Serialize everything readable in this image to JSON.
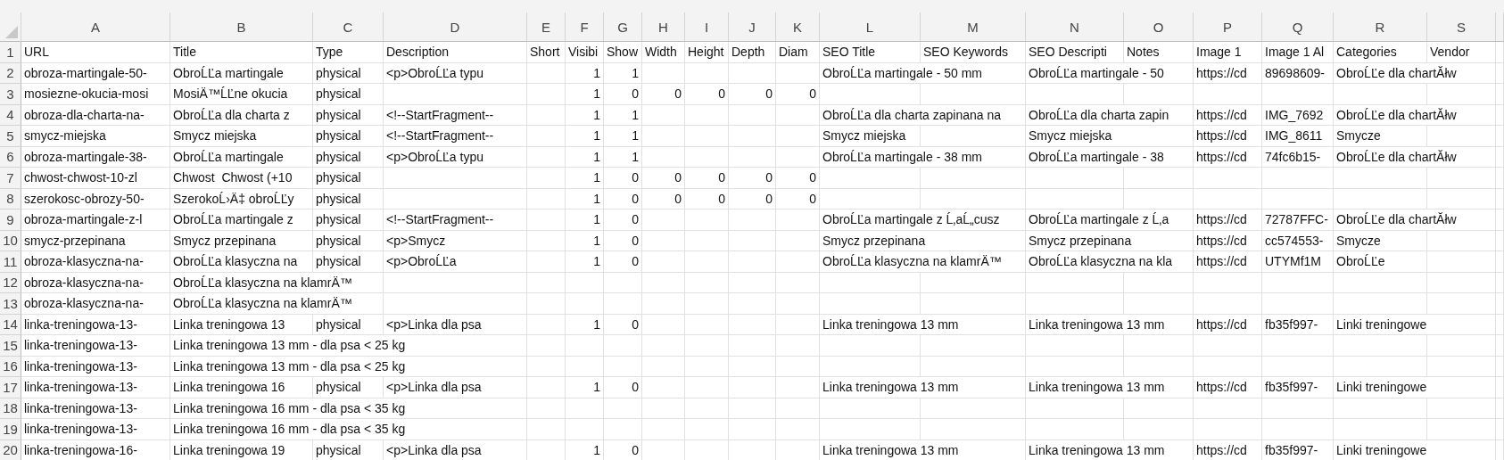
{
  "columns": [
    "A",
    "B",
    "C",
    "D",
    "E",
    "F",
    "G",
    "H",
    "I",
    "J",
    "K",
    "L",
    "M",
    "N",
    "O",
    "P",
    "Q",
    "R",
    "S"
  ],
  "rows": [
    {
      "number": "1",
      "cells": {
        "A": "URL",
        "B": "Title",
        "C": "Type",
        "D": "Description",
        "E": "Short",
        "F": "Visibi",
        "G": "Show",
        "H": "Width",
        "I": "Height",
        "J": "Depth",
        "K": "Diam",
        "L": "SEO Title",
        "M": "SEO Keywords",
        "N": "SEO Descripti",
        "O": "Notes",
        "P": "Image 1",
        "Q": "Image 1 Al",
        "R": "Categories",
        "S": "Vendor"
      }
    },
    {
      "number": "2",
      "cells": {
        "A": "obroza-martingale-50-",
        "B": "ObroĹĽa martingale",
        "C": "physical",
        "D": "<p>ObroĹĽa typu",
        "F": "1",
        "G": "1",
        "L": "ObroĹĽa martingale - 50 mm",
        "N": "ObroĹĽa martingale - 50",
        "P": "https://cd",
        "Q": "89698609-",
        "R": "ObroĹĽe dla chartĂłw"
      }
    },
    {
      "number": "3",
      "cells": {
        "A": "mosiezne-okucia-mosi",
        "B": "MosiÄ™ĹĽne okucia",
        "C": "physical",
        "F": "1",
        "G": "0",
        "H": "0",
        "I": "0",
        "J": "0",
        "K": "0"
      }
    },
    {
      "number": "4",
      "cells": {
        "A": "obroza-dla-charta-na-",
        "B": "ObroĹĽa dla charta z",
        "C": "physical",
        "D": "<!--StartFragment--",
        "F": "1",
        "G": "1",
        "L": "ObroĹĽa dla charta zapinana na",
        "N": "ObroĹĽa dla charta zapin",
        "P": "https://cd",
        "Q": "IMG_7692",
        "R": "ObroĹĽe dla chartĂłw"
      }
    },
    {
      "number": "5",
      "cells": {
        "A": "smycz-miejska",
        "B": "Smycz miejska",
        "C": "physical",
        "D": "<!--StartFragment--",
        "F": "1",
        "G": "1",
        "L": "Smycz miejska",
        "N": "Smycz miejska",
        "P": "https://cd",
        "Q": "IMG_8611",
        "R": "Smycze"
      }
    },
    {
      "number": "6",
      "cells": {
        "A": "obroza-martingale-38-",
        "B": "ObroĹĽa martingale",
        "C": "physical",
        "D": "<p>ObroĹĽa typu",
        "F": "1",
        "G": "1",
        "L": "ObroĹĽa martingale - 38 mm",
        "N": "ObroĹĽa martingale - 38",
        "P": "https://cd",
        "Q": "74fc6b15-",
        "R": "ObroĹĽe dla chartĂłw"
      }
    },
    {
      "number": "7",
      "cells": {
        "A": "chwost-chwost-10-zl",
        "B": "Chwost  Chwost (+10",
        "C": "physical",
        "F": "1",
        "G": "0",
        "H": "0",
        "I": "0",
        "J": "0",
        "K": "0"
      }
    },
    {
      "number": "8",
      "cells": {
        "A": "szerokosc-obrozy-50-",
        "B": "SzerokoĹ›Ä‡ obroĹĽy",
        "C": "physical",
        "F": "1",
        "G": "0",
        "H": "0",
        "I": "0",
        "J": "0",
        "K": "0"
      }
    },
    {
      "number": "9",
      "cells": {
        "A": "obroza-martingale-z-l",
        "B": "ObroĹĽa martingale z",
        "C": "physical",
        "D": "<!--StartFragment--",
        "F": "1",
        "G": "0",
        "L": "ObroĹĽa martingale z Ĺ‚aĹ„cusz",
        "N": "ObroĹĽa martingale z Ĺ‚a",
        "P": "https://cd",
        "Q": "72787FFC-",
        "R": "ObroĹĽe dla chartĂłw"
      }
    },
    {
      "number": "10",
      "cells": {
        "A": "smycz-przepinana",
        "B": "Smycz przepinana",
        "C": "physical",
        "D": "<p>Smycz",
        "F": "1",
        "G": "0",
        "L": "Smycz przepinana",
        "N": "Smycz przepinana",
        "P": "https://cd",
        "Q": "cc574553-",
        "R": "Smycze"
      }
    },
    {
      "number": "11",
      "cells": {
        "A": "obroza-klasyczna-na-",
        "B": "ObroĹĽa klasyczna na",
        "C": "physical",
        "D": "<p>ObroĹĽa",
        "F": "1",
        "G": "0",
        "L": "ObroĹĽa klasyczna na klamrÄ™",
        "N": "ObroĹĽa klasyczna na kla",
        "P": "https://cd",
        "Q": "UTYMf1M",
        "R": "ObroĹĽe"
      }
    },
    {
      "number": "12",
      "cells": {
        "A": "obroza-klasyczna-na-",
        "B": "ObroĹĽa klasyczna na klamrÄ™"
      }
    },
    {
      "number": "13",
      "cells": {
        "A": "obroza-klasyczna-na-",
        "B": "ObroĹĽa klasyczna na klamrÄ™"
      }
    },
    {
      "number": "14",
      "cells": {
        "A": "linka-treningowa-13-",
        "B": "Linka treningowa 13",
        "C": "physical",
        "D": "<p>Linka dla psa",
        "F": "1",
        "G": "0",
        "L": "Linka treningowa 13 mm",
        "N": "Linka treningowa 13 mm",
        "P": "https://cd",
        "Q": "fb35f997-",
        "R": "Linki treningowe"
      }
    },
    {
      "number": "15",
      "cells": {
        "A": "linka-treningowa-13-",
        "B": "Linka treningowa 13 mm - dla psa < 25 kg"
      }
    },
    {
      "number": "16",
      "cells": {
        "A": "linka-treningowa-13-",
        "B": "Linka treningowa 13 mm - dla psa < 25 kg"
      }
    },
    {
      "number": "17",
      "cells": {
        "A": "linka-treningowa-13-",
        "B": "Linka treningowa 16",
        "C": "physical",
        "D": "<p>Linka dla psa",
        "F": "1",
        "G": "0",
        "L": "Linka treningowa 13 mm",
        "N": "Linka treningowa 13 mm",
        "P": "https://cd",
        "Q": "fb35f997-",
        "R": "Linki treningowe"
      }
    },
    {
      "number": "18",
      "cells": {
        "A": "linka-treningowa-13-",
        "B": "Linka treningowa 16 mm - dla psa < 35 kg"
      }
    },
    {
      "number": "19",
      "cells": {
        "A": "linka-treningowa-13-",
        "B": "Linka treningowa 16 mm - dla psa < 35 kg"
      }
    },
    {
      "number": "20",
      "cells": {
        "A": "linka-treningowa-16-",
        "B": "Linka treningowa 19",
        "C": "physical",
        "D": "<p>Linka dla psa",
        "F": "1",
        "G": "0",
        "L": "Linka treningowa 13 mm",
        "N": "Linka treningowa 13 mm",
        "P": "https://cd",
        "Q": "fb35f997-",
        "R": "Linki treningowe"
      }
    }
  ]
}
